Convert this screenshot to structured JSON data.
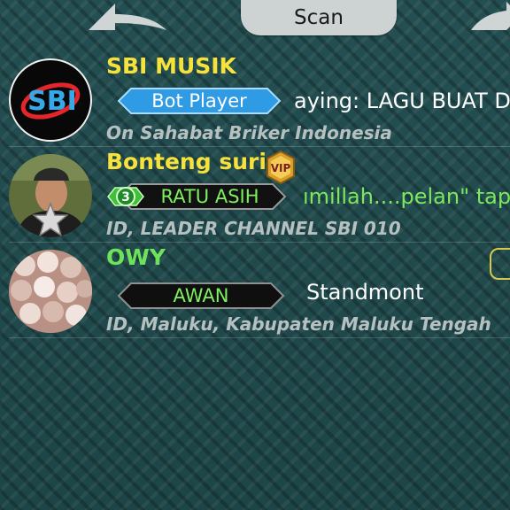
{
  "header": {
    "title": "Scan",
    "back_icon": "arrow-left-icon",
    "forward_icon": "arrow-right-icon"
  },
  "contacts": [
    {
      "name": "SBI MUSIK",
      "avatar_text": "SBI",
      "badge": "Bot Player",
      "status": "aying: LAGU BUAT D",
      "location": "On Sahabat Briker Indonesia"
    },
    {
      "name": "Bonteng suri",
      "vip_label": "VIP",
      "level": "3",
      "badge": "RATU ASIH",
      "status": "ımillah....pelan\" tap",
      "location": "ID, LEADER CHANNEL SBI 010"
    },
    {
      "name": "OWY",
      "badge": "AWAN",
      "status": "Standmont",
      "location": "ID, Maluku, Kabupaten Maluku Tengah"
    }
  ],
  "colors": {
    "name_yellow": "#f6e23a",
    "name_green": "#6ee35a",
    "badge_blue": "#2f9be4",
    "status_green": "#7de85e",
    "background": "#1f4a4c"
  }
}
